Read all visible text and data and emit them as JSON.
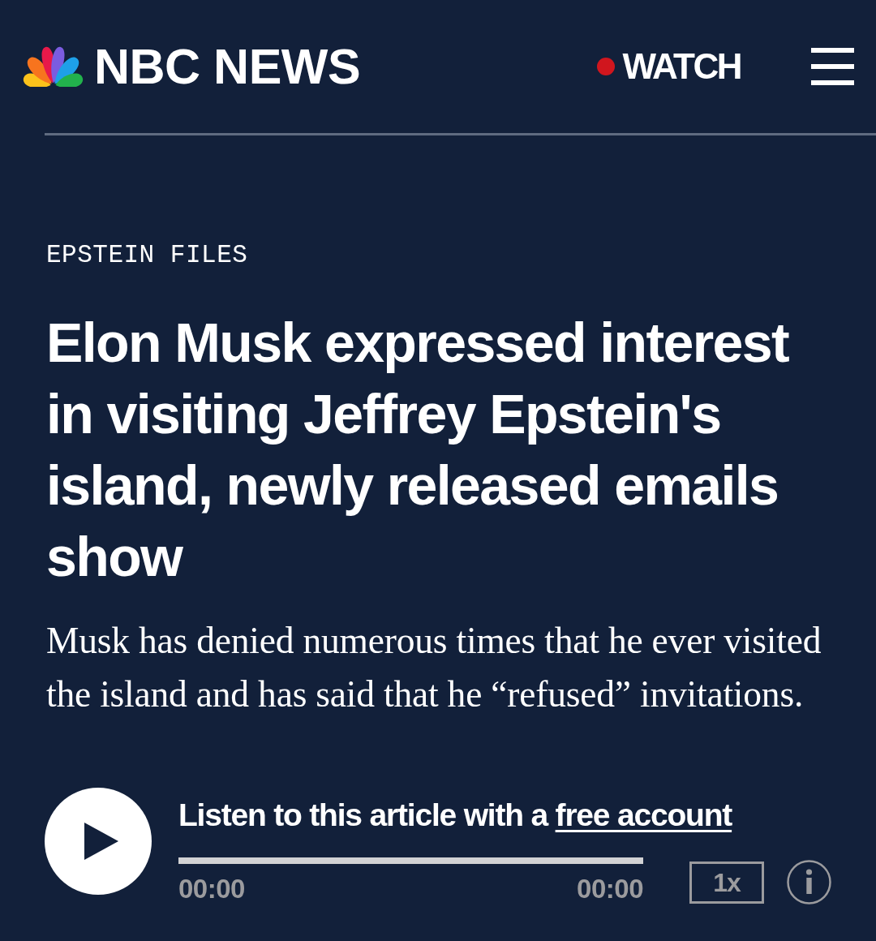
{
  "header": {
    "logo_text": "NBC NEWS",
    "watch_label": "WATCH"
  },
  "article": {
    "category": "EPSTEIN FILES",
    "headline": "Elon Musk expressed interest in visiting Jeffrey Epstein's island, newly released emails show",
    "deck": "Musk has denied numerous times that he ever visited the island and has said that he “refused” invitations."
  },
  "player": {
    "prompt": "Listen to this article with a",
    "prompt_link": "free account",
    "elapsed": "00:00",
    "duration": "00:00",
    "speed": "1x"
  }
}
